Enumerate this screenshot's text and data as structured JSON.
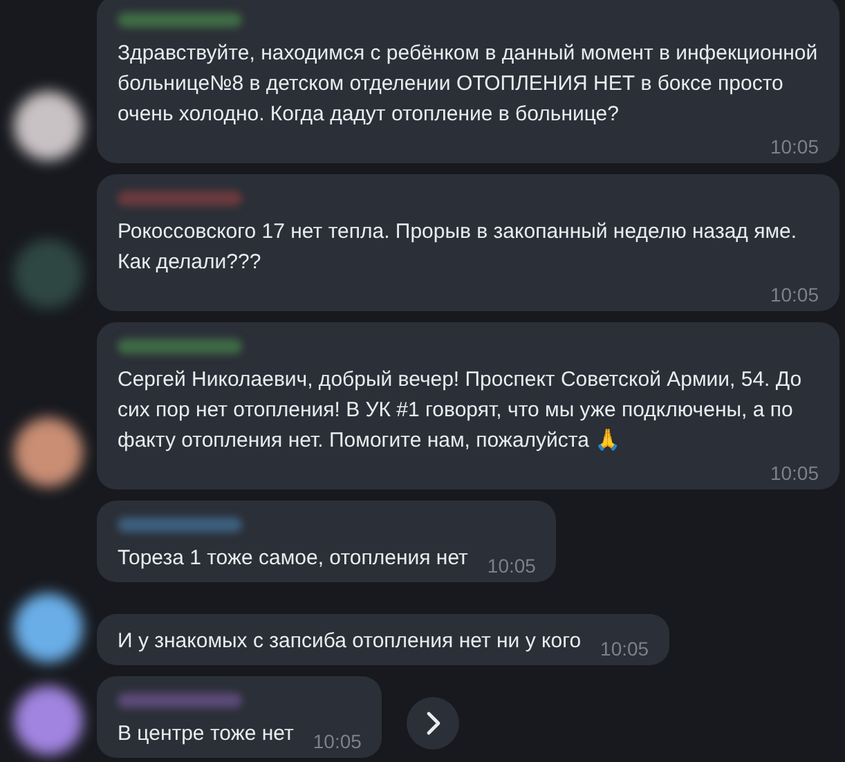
{
  "messages": [
    {
      "sender_blur": {
        "color": "#3f6b45"
      },
      "avatar": {
        "color": "#c9c2c4"
      },
      "text": "Здравствуйте, находимся с ребёнком в данный момент в инфекционной больнице№8 в детском отделении ОТОПЛЕНИЯ НЕТ в боксе просто очень холодно. Когда дадут отопление в больнице?",
      "time": "10:05"
    },
    {
      "sender_blur": {
        "color": "#6b3a3e"
      },
      "avatar": {
        "color": "#2f4742"
      },
      "text": "Рокоссовского 17 нет тепла. Прорыв в закопанный неделю назад яме. Как делали???",
      "time": "10:05"
    },
    {
      "sender_blur": {
        "color": "#3f6b45"
      },
      "avatar": {
        "color": "#c98e74"
      },
      "text": "Сергей Николаевич, добрый вечер! Проспект Советской Армии, 54. До сих пор нет отопления! В УК #1 говорят, что мы уже подключены, а по факту отопления нет. Помогите нам, пожалуйста 🙏",
      "time": "10:05"
    },
    {
      "sender_blur": {
        "color": "#3d5f7e"
      },
      "text": "Тореза 1 тоже самое, отопления нет",
      "time": "10:05"
    },
    {
      "avatar": {
        "color": "#6aaee8"
      },
      "text": "И у знакомых с запсиба отопления нет ни у кого",
      "time": "10:05"
    },
    {
      "sender_blur": {
        "color": "#5b4a78"
      },
      "avatar": {
        "color": "#a184e0"
      },
      "text": "В центре тоже нет",
      "time": "10:05",
      "forward_button": true
    }
  ]
}
